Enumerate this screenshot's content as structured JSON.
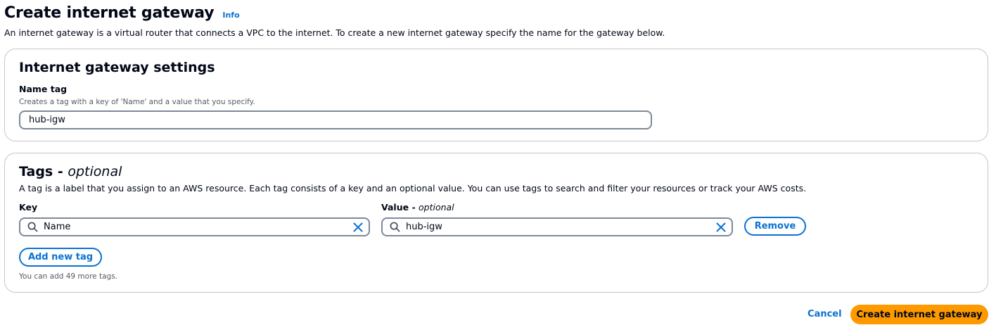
{
  "header": {
    "title": "Create internet gateway",
    "info_label": "Info",
    "description": "An internet gateway is a virtual router that connects a VPC to the internet. To create a new internet gateway specify the name for the gateway below."
  },
  "settings": {
    "heading": "Internet gateway settings",
    "name_tag_label": "Name tag",
    "name_tag_hint": "Creates a tag with a key of 'Name' and a value that you specify.",
    "name_tag_value": "hub-igw"
  },
  "tags": {
    "heading": "Tags - ",
    "heading_optional": "optional",
    "description": "A tag is a label that you assign to an AWS resource. Each tag consists of a key and an optional value. You can use tags to search and filter your resources or track your AWS costs.",
    "key_label": "Key",
    "value_label": "Value - ",
    "value_label_optional": "optional",
    "rows": [
      {
        "key": "Name",
        "value": "hub-igw"
      }
    ],
    "remove_label": "Remove",
    "add_label": "Add new tag",
    "limit_hint": "You can add 49 more tags."
  },
  "footer": {
    "cancel_label": "Cancel",
    "create_label": "Create internet gateway"
  },
  "icons": {
    "search": "search-icon",
    "clear": "close-icon"
  },
  "colors": {
    "link": "#0972d3",
    "primary_button": "#ff9900",
    "text": "#000716",
    "border": "#c6c6cd"
  }
}
